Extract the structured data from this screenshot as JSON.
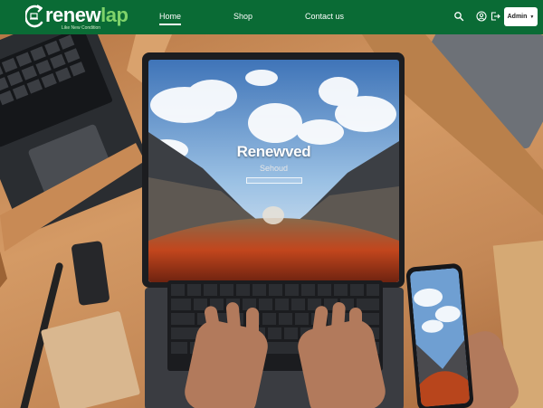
{
  "brand": {
    "name_part1": "renew",
    "name_part2": "lap",
    "tagline": "Like New Condition",
    "colors": {
      "navbar": "#0a6b35",
      "accent": "#7fd36a"
    }
  },
  "nav": {
    "links": [
      {
        "label": "Home",
        "active": true
      },
      {
        "label": "Shop",
        "active": false
      },
      {
        "label": "Contact us",
        "active": false
      }
    ],
    "icons": [
      "search-icon",
      "user-icon",
      "logout-icon"
    ],
    "admin_label": "Admin"
  },
  "hero": {
    "screen_title": "Renewved",
    "screen_subtitle": "Sehoud"
  }
}
